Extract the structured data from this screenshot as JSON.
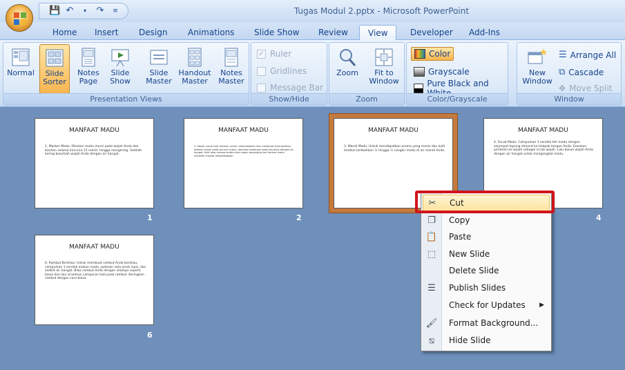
{
  "window": {
    "title": "Tugas Modul 2.pptx - Microsoft PowerPoint"
  },
  "qat": {
    "icons": [
      "save-icon",
      "undo-icon",
      "redo-icon",
      "customize-icon"
    ]
  },
  "tabs": [
    "Home",
    "Insert",
    "Design",
    "Animations",
    "Slide Show",
    "Review",
    "View",
    "Developer",
    "Add-Ins"
  ],
  "active_tab": "View",
  "ribbon": {
    "presentation_views": {
      "label": "Presentation Views",
      "buttons": [
        {
          "line1": "Normal",
          "line2": ""
        },
        {
          "line1": "Slide",
          "line2": "Sorter"
        },
        {
          "line1": "Notes",
          "line2": "Page"
        },
        {
          "line1": "Slide",
          "line2": "Show"
        },
        {
          "line1": "Slide",
          "line2": "Master"
        },
        {
          "line1": "Handout",
          "line2": "Master"
        },
        {
          "line1": "Notes",
          "line2": "Master"
        }
      ]
    },
    "show_hide": {
      "label": "Show/Hide",
      "items": [
        "Ruler",
        "Gridlines",
        "Message Bar"
      ]
    },
    "zoom": {
      "label": "Zoom",
      "zoom_label": "Zoom",
      "fit_line1": "Fit to",
      "fit_line2": "Window"
    },
    "color_grayscale": {
      "label": "Color/Grayscale",
      "items": [
        "Color",
        "Grayscale",
        "Pure Black and White"
      ]
    },
    "window": {
      "label": "Window",
      "new_line1": "New",
      "new_line2": "Window",
      "arrange_all": "Arrange All",
      "cascade": "Cascade",
      "move_split": "Move Split"
    }
  },
  "slides": [
    {
      "num": "1",
      "title": "MANFAAT MADU",
      "body": "1. Masker Madu: Oleskan madu murni pada wajah Anda dan biarkan selama kira-kira 15 menit, hingga mengering. Setelah kering basuhlah wajah Anda dengan air hangat."
    },
    {
      "num": "2",
      "title": "MANFAAT MADU",
      "body": "2. Mandi untuk kulit lembut: untuk melembabkan dan membuat kulit berkilau, oleskan madu pada seluruh tubuh, diamkan beberapa saat lalu bilas dengan air hangat. Kulit akan terasa lembut dan segar sepanjang hari karena madu memiliki khasiat melembabkan."
    },
    {
      "num": "3",
      "title": "MANFAAT MADU",
      "body": "3. Mandi Madu: Untuk mendapatkan aroma yang manis dan kulit lembut tambahkan ¼ hingga ½ cangkir madu di air mandi Anda."
    },
    {
      "num": "4",
      "title": "MANFAAT MADU",
      "body": "4. Scrub Madu: Campurkan 1 sendok teh madu dengan sejumput tepung almond ke telapak tangan Anda. Gosokan perlahan ke wajah sebagai scrub wajah. Lalu basuh wajah Anda dengan air hangat untuk mengangkat madu."
    },
    {
      "num": "6",
      "title": "MANFAAT MADU",
      "body": "6. Rambut Berkilau: Untuk membuat rambut Anda berkilau, campurkan 1 sendok makan madu, potesan satu jeruk nipis, dan sedikit air hangat. Bilas rambut Anda dengan shampo seperti biasa dan lalu siramkan campuran tadi pada rambut. Keringkan rambut dengan cara biasa."
    }
  ],
  "context_menu": {
    "items": [
      {
        "label": "Cut",
        "icon": "scissors-icon"
      },
      {
        "label": "Copy",
        "icon": "copy-icon"
      },
      {
        "label": "Paste",
        "icon": "paste-icon"
      },
      {
        "label": "New Slide",
        "icon": "new-slide-icon"
      },
      {
        "label": "Delete Slide",
        "icon": ""
      },
      {
        "label": "Publish Slides",
        "icon": "publish-slides-icon"
      },
      {
        "label": "Check for Updates",
        "icon": ""
      },
      {
        "label": "Format Background...",
        "icon": "format-background-icon"
      },
      {
        "label": "Hide Slide",
        "icon": "hide-slide-icon"
      }
    ]
  },
  "colors": {
    "highlight_border": "#d1141c",
    "selected_slide_frame": "#c57a3c",
    "workspace": "#6e90bb"
  }
}
